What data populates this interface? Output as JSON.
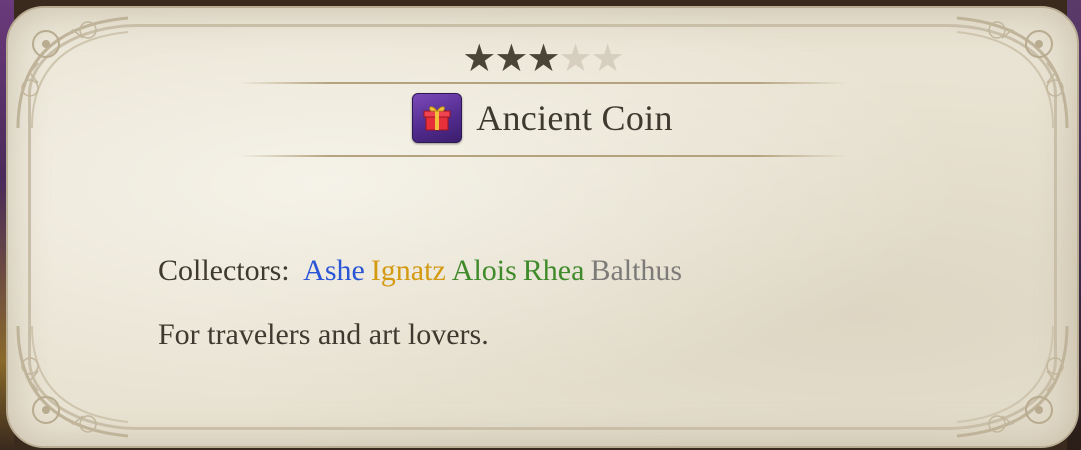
{
  "item": {
    "rating_filled": 3,
    "rating_max": 5,
    "star_glyph": "★",
    "icon": "gift-icon",
    "name": "Ancient Coin"
  },
  "collectors": {
    "label": "Collectors:",
    "names": [
      {
        "name": "Ashe",
        "color": "#2a55d6"
      },
      {
        "name": "Ignatz",
        "color": "#d39a12"
      },
      {
        "name": "Alois",
        "color": "#3f8a2a"
      },
      {
        "name": "Rhea",
        "color": "#3f8a2a"
      },
      {
        "name": "Balthus",
        "color": "#7d7b78"
      }
    ]
  },
  "description": "For travelers and art lovers.",
  "colors": {
    "parchment": "#e9e3d3",
    "text": "#3e3a30",
    "star_filled": "#4b4538",
    "star_empty": "#d6cfbf",
    "icon_bg": "#5a2f9a"
  }
}
